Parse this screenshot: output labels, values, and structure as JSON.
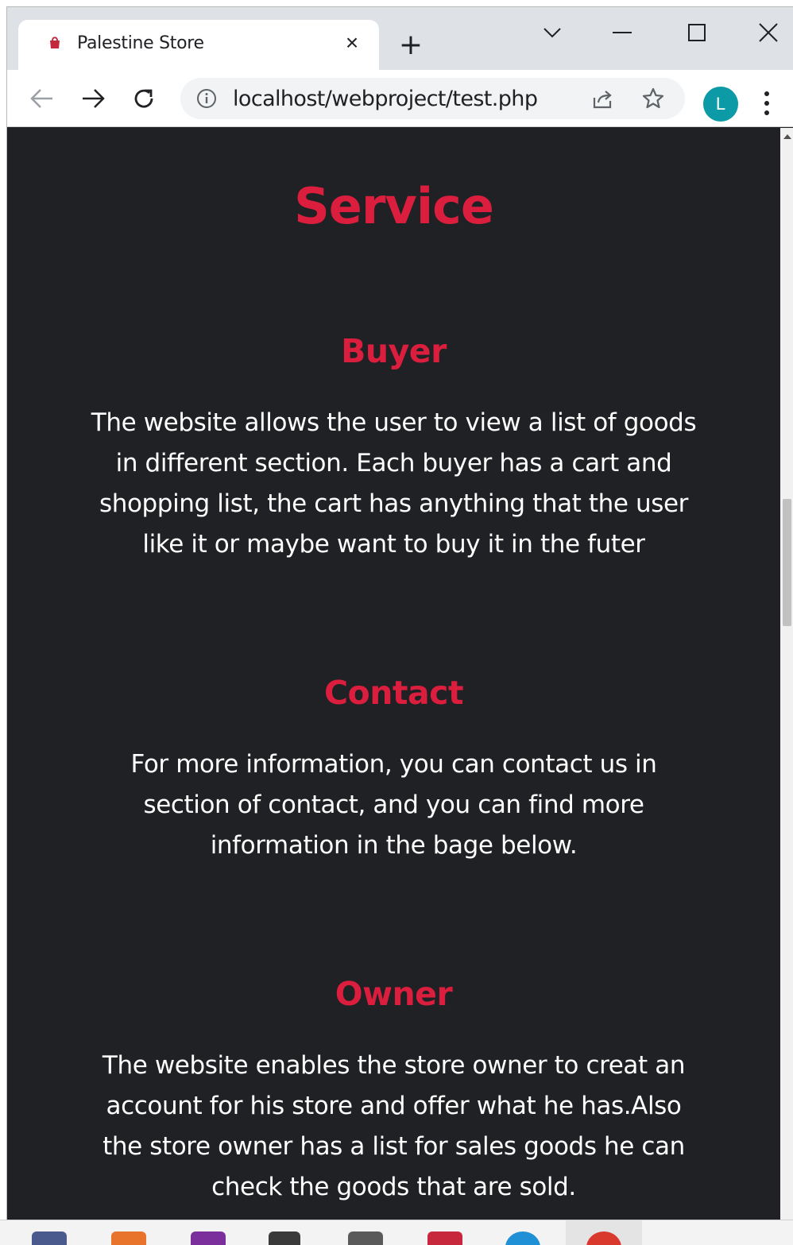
{
  "browser": {
    "tab_title": "Palestine Store",
    "tab_close": "×",
    "new_tab": "+",
    "url": "localhost/webproject/test.php",
    "avatar_letter": "L",
    "accent_color": "#0b9aa6"
  },
  "page": {
    "title": "Service",
    "sections": [
      {
        "heading": "Buyer",
        "lines": [
          "The website allows the user to view a list of goods",
          "in different section. Each buyer has a cart and",
          "shopping list, the cart has anything that the user",
          "like it or maybe want to buy it in the futer"
        ]
      },
      {
        "heading": "Contact",
        "lines": [
          "For more information, you can contact us in",
          "section of contact, and you can find more",
          "information in the bage below."
        ]
      },
      {
        "heading": "Owner",
        "lines": [
          "The website enables the store owner to creat an",
          "account for his store and offer what he has.Also",
          "the store owner has a list for sales goods he can",
          "check the goods that are sold."
        ]
      }
    ],
    "heading_color": "#dc1e3e",
    "background_color": "#202124"
  },
  "taskbar": {
    "icons": [
      "file-explorer-icon",
      "app-icon",
      "photoshop-icon",
      "app-icon-2",
      "media-icon",
      "gmail-icon",
      "edge-icon",
      "chrome-icon"
    ]
  }
}
